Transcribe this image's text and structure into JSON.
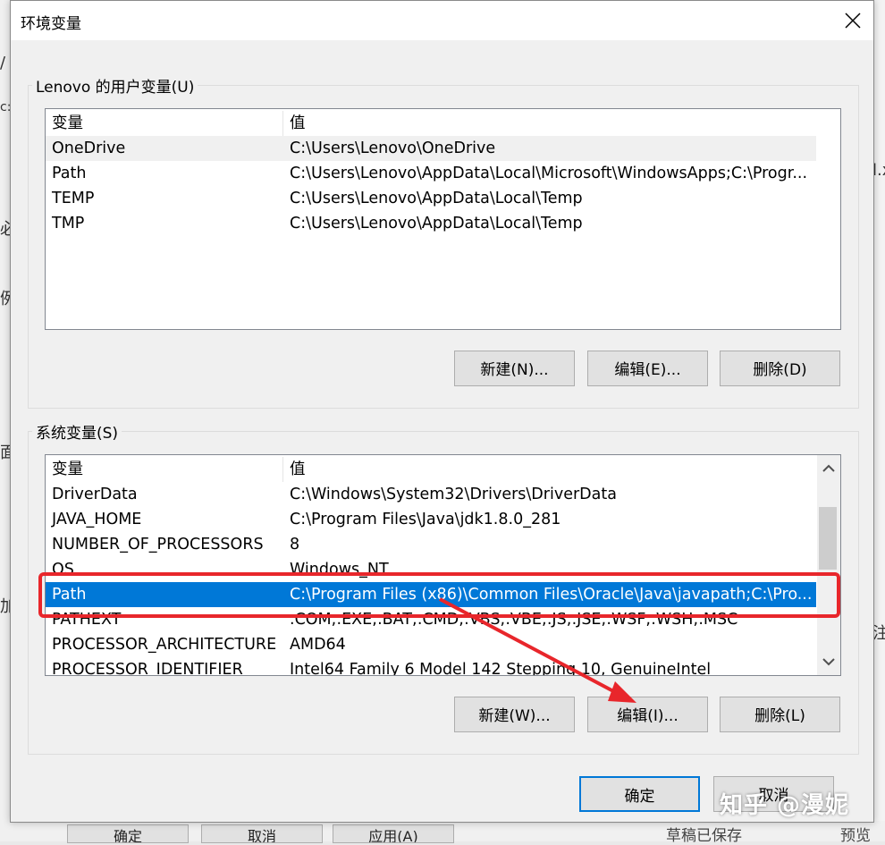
{
  "dialog": {
    "title": "环境变量",
    "close_glyph": "✕"
  },
  "user_section": {
    "label": "Lenovo 的用户变量(U)",
    "columns": {
      "name": "变量",
      "value": "值"
    },
    "rows": [
      {
        "name": "OneDrive",
        "value": "C:\\Users\\Lenovo\\OneDrive"
      },
      {
        "name": "Path",
        "value": "C:\\Users\\Lenovo\\AppData\\Local\\Microsoft\\WindowsApps;C:\\Progr..."
      },
      {
        "name": "TEMP",
        "value": "C:\\Users\\Lenovo\\AppData\\Local\\Temp"
      },
      {
        "name": "TMP",
        "value": "C:\\Users\\Lenovo\\AppData\\Local\\Temp"
      }
    ],
    "buttons": {
      "new": "新建(N)...",
      "edit": "编辑(E)...",
      "delete": "删除(D)"
    }
  },
  "system_section": {
    "label": "系统变量(S)",
    "columns": {
      "name": "变量",
      "value": "值"
    },
    "rows": [
      {
        "name": "DriverData",
        "value": "C:\\Windows\\System32\\Drivers\\DriverData"
      },
      {
        "name": "JAVA_HOME",
        "value": "C:\\Program Files\\Java\\jdk1.8.0_281"
      },
      {
        "name": "NUMBER_OF_PROCESSORS",
        "value": "8"
      },
      {
        "name": "OS",
        "value": "Windows_NT"
      },
      {
        "name": "Path",
        "value": "C:\\Program Files (x86)\\Common Files\\Oracle\\Java\\javapath;C:\\Pro..."
      },
      {
        "name": "PATHEXT",
        "value": ".COM;.EXE;.BAT;.CMD;.VBS;.VBE;.JS;.JSE;.WSF;.WSH;.MSC"
      },
      {
        "name": "PROCESSOR_ARCHITECTURE",
        "value": "AMD64"
      },
      {
        "name": "PROCESSOR_IDENTIFIER",
        "value": "Intel64 Family 6 Model 142 Stepping 10, GenuineIntel"
      }
    ],
    "selected_index": 4,
    "buttons": {
      "new": "新建(W)...",
      "edit": "编辑(I)...",
      "delete": "删除(L)"
    }
  },
  "footer": {
    "ok": "确定",
    "cancel": "取消"
  },
  "background": {
    "frag_slash": "/",
    "frag_c": "c:",
    "frag_bi": "必",
    "frag_li": "例",
    "frag_mian": "面",
    "frag_jia": "加",
    "frag_x": "l.x",
    "frag_zhu": "注",
    "btn_ok": "确定",
    "btn_cancel": "取消",
    "btn_apply": "应用(A)",
    "status": "草稿已保存",
    "status_right": "预览"
  },
  "watermark": "知乎 @漫妮",
  "annotation_color": "#e8262b",
  "accent_color": "#0078d7"
}
